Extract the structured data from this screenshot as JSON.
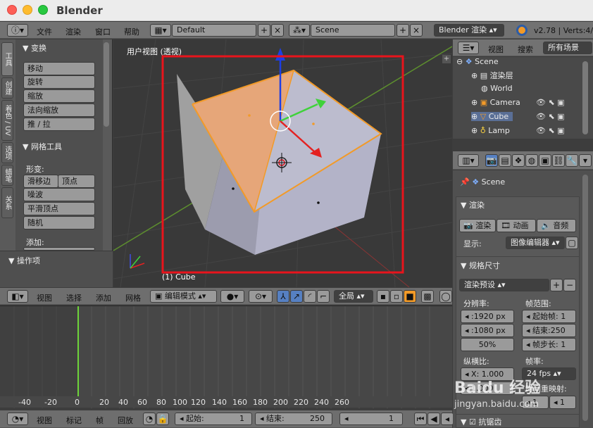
{
  "app": {
    "title": "Blender"
  },
  "menubar": {
    "menus": [
      "文件",
      "渲染",
      "窗口",
      "帮助"
    ],
    "layout": "Default",
    "scene": "Scene",
    "engine": "Blender 渲染",
    "version": "v2.78 | Verts:4/8"
  },
  "toolshelf": {
    "tabs": [
      "工具",
      "创建",
      "着色 / UV",
      "选项",
      "蜡笔",
      "关系"
    ],
    "transform_title": "变换",
    "transform_buttons": [
      "移动",
      "旋转",
      "缩放",
      "法向缩放",
      "推 / 拉"
    ],
    "mesh_tools_title": "网格工具",
    "deform_label": "形变:",
    "slide_edge": "滑移边",
    "vertex": "顶点",
    "noise": "噪波",
    "smooth_vertex": "平滑顶点",
    "random": "随机",
    "add_label": "添加:",
    "operator_title": "操作项"
  },
  "viewport": {
    "view_label": "用户视图 (透视)",
    "object_label": "(1) Cube",
    "header": {
      "menus": [
        "视图",
        "选择",
        "添加",
        "网格"
      ],
      "mode": "编辑模式",
      "orientation": "全局"
    }
  },
  "outliner": {
    "header": {
      "view": "视图",
      "search": "搜索",
      "filter": "所有场景"
    },
    "items": [
      "Scene",
      "渲染层",
      "World",
      "Camera",
      "Cube",
      "Lamp"
    ]
  },
  "properties": {
    "scene_label": "Scene",
    "render_title": "渲染",
    "render_buttons": [
      "渲染",
      "动画",
      "音频"
    ],
    "display_label": "显示:",
    "display_value": "图像编辑器",
    "dimensions_title": "规格尺寸",
    "preset": "渲染预设",
    "resolution_label": "分辨率:",
    "res_x": ":1920 px",
    "res_y": ":1080 px",
    "res_pct": "50%",
    "frame_range_label": "帧范围:",
    "start_frame": "起始帧: 1",
    "end_frame": "结束:250",
    "frame_step": "帧步长: 1",
    "aspect_label": "纵横比:",
    "aspect_x": "X: 1.000",
    "aspect_y": "1.000",
    "fps_label": "帧率:",
    "fps": "24 fps",
    "time_remap": "时间重映射:",
    "remap_old": "1",
    "remap_new": "1",
    "antialias": "抗锯齿"
  },
  "timeline": {
    "ticks": [
      "-40",
      "-20",
      "0",
      "20",
      "40",
      "60",
      "80",
      "100",
      "120",
      "140",
      "160",
      "180",
      "200",
      "220",
      "240",
      "260"
    ],
    "current_frame": 1,
    "header": {
      "menus": [
        "视图",
        "标记",
        "帧",
        "回放"
      ],
      "start": "起始:",
      "start_value": "1",
      "end": "结束:",
      "end_value": "250",
      "current": "1"
    }
  },
  "watermark": "Baidu 经验",
  "watermark_sub": "jingyan.baidu.com",
  "colors": {
    "highlight_box": "#e8141c",
    "selected_face": "#e6a679",
    "accent_orange": "#f29a28"
  }
}
